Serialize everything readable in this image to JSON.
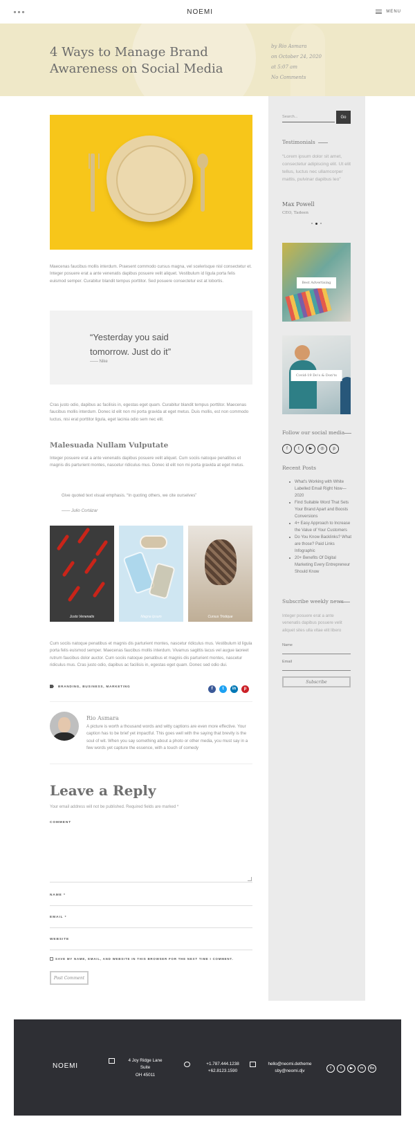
{
  "header": {
    "logo": "NOEMI",
    "menu_label": "MENU"
  },
  "hero": {
    "title": "4 Ways to Manage Brand Awareness on Social Media",
    "author": "by Rio Asmara",
    "date": "on October 24, 2020",
    "time": "at 5:07 am",
    "comments": "No Comments"
  },
  "article": {
    "para1": "Maecenas faucibus mollis interdum. Praesent commodo cursus magna, vel scelerisque nisl consectetur et. Integer posuere erat a ante venenatis dapibus posuere velit aliquet. Vestibulum id ligula porta felis euismod semper. Curabitur blandit tempus porttitor. Sed posuere consectetur est at lobortis.",
    "quote": "“Yesterday you said tomorrow. Just do it”",
    "quote_by": "—— Nike",
    "para2": "Cras justo odio, dapibus ac facilisis in, egestas eget quam. Curabitur blandit tempus porttitor. Maecenas faucibus mollis interdum. Donec id elit non mi porta gravida at eget metus. Duis mollis, est non commodo luctus, nisi erat porttitor ligula, eget lacinia odio sem nec elit.",
    "heading": "Malesuada Nullam Vulputate",
    "para3": "Integer posuere erat a ante venenatis dapibus posuere velit aliquet. Cum sociis natoque penatibus et magnis dis parturient montes, nascetur ridiculus mus. Donec id elit non mi porta gravida at eget metus.",
    "blockquote": "Give quoted text visual emphasis. “In quoting others, we cite ourselves”",
    "blockquote_by": "—— Julio Cortázar",
    "gallery": [
      "Justo Venenatis",
      "Magna Ipsum",
      "Cursus Tristique"
    ],
    "para4": "Cum sociis natoque penatibus et magnis dis parturient montes, nascetur ridiculus mus. Vestibulum id ligula porta felis euismod semper. Maecenas faucibus mollis interdum. Vivamus sagittis lacus vel augue laoreet rutrum faucibus dolor auctor. Cum sociis natoque penatibus et magnis dis parturient montes, nascetur ridiculus mus. Cras justo odio, dapibus ac facilisis in, egestas eget quam. Donec sed odio dui.",
    "tags": "BRANDING, BUSINESS, MARKETING"
  },
  "author_box": {
    "name": "Rio Asmara",
    "bio": "A picture is worth a thousand words and witty captions are even more effective. Your caption has to be brief yet impactful. This goes well with the saying that brevity is the soul of wit. When you say something about a photo or other media, you must say in a few words yet capture the essence, with a touch of comedy"
  },
  "reply": {
    "title": "Leave a Reply",
    "note": "Your email address will not be published. Required fields are marked *",
    "comment_label": "COMMENT",
    "name_label": "NAME *",
    "email_label": "EMAIL *",
    "website_label": "WEBSITE",
    "save_label": "SAVE MY NAME, EMAIL, AND WEBSITE IN THIS BROWSER FOR THE NEXT TIME I COMMENT.",
    "submit_label": "Post Comment"
  },
  "sidebar": {
    "search_placeholder": "Search...",
    "go_label": "Go",
    "testimonials_title": "Testimonials",
    "testimonial_text": "“Lorem ipsum dolor sit amet, consectetur adipiscing elit. Ut elit tellus, luctus nec ullamcorper mattis, pulvinar dapibus leo”",
    "testimonial_name": "Max Powell",
    "testimonial_role": "CEO, Tadeen",
    "card1": "Best Advertising",
    "card2": "Covid-19 Do's & Don'ts",
    "follow_title": "Follow our social media",
    "social_icons": [
      "facebook-icon",
      "twitter-icon",
      "youtube-icon",
      "instagram-icon",
      "pinterest-icon"
    ],
    "recent_title": "Recent Posts",
    "recent_posts": [
      "What's Working with White Labelled Email Right Now—2020",
      "Find Suitable Word That Sets Your Brand Apart and Boosts Conversions",
      "4+ Easy Approach to Increase the Value of Your Customers",
      "Do You Know Backlinks? What are those? Paid Links Infographic",
      "20+ Benefits Of Digital Marketing Every Entrepreneur Should Know"
    ],
    "subscribe_title": "Subscribe weekly news",
    "subscribe_text": "Integer posuere erat a ante venenatis dapibus posuere velit aliquet sites ulla vitae elit libero",
    "name_placeholder": "Name",
    "email_placeholder": "Email",
    "subscribe_label": "Subscribe"
  },
  "footer": {
    "logo": "NOEMI",
    "address_line1": "4 Joy Ridge Lane",
    "address_line2": "Suite",
    "address_line3": "OH 45011",
    "phone1": "+1.787.444.1238",
    "phone2": "+62.8123.1590",
    "email1": "hello@neomi.detheme",
    "email2": "sby@neomi.djv"
  },
  "colors": {
    "hero_bg": "#efe8c8",
    "feature_bg": "#f7c61a",
    "sidebar_bg": "#ebebeb",
    "footer_bg": "#2e2f34",
    "facebook": "#3b5998",
    "twitter": "#1da1f2",
    "linkedin": "#0077b5",
    "pinterest": "#cb2027"
  }
}
